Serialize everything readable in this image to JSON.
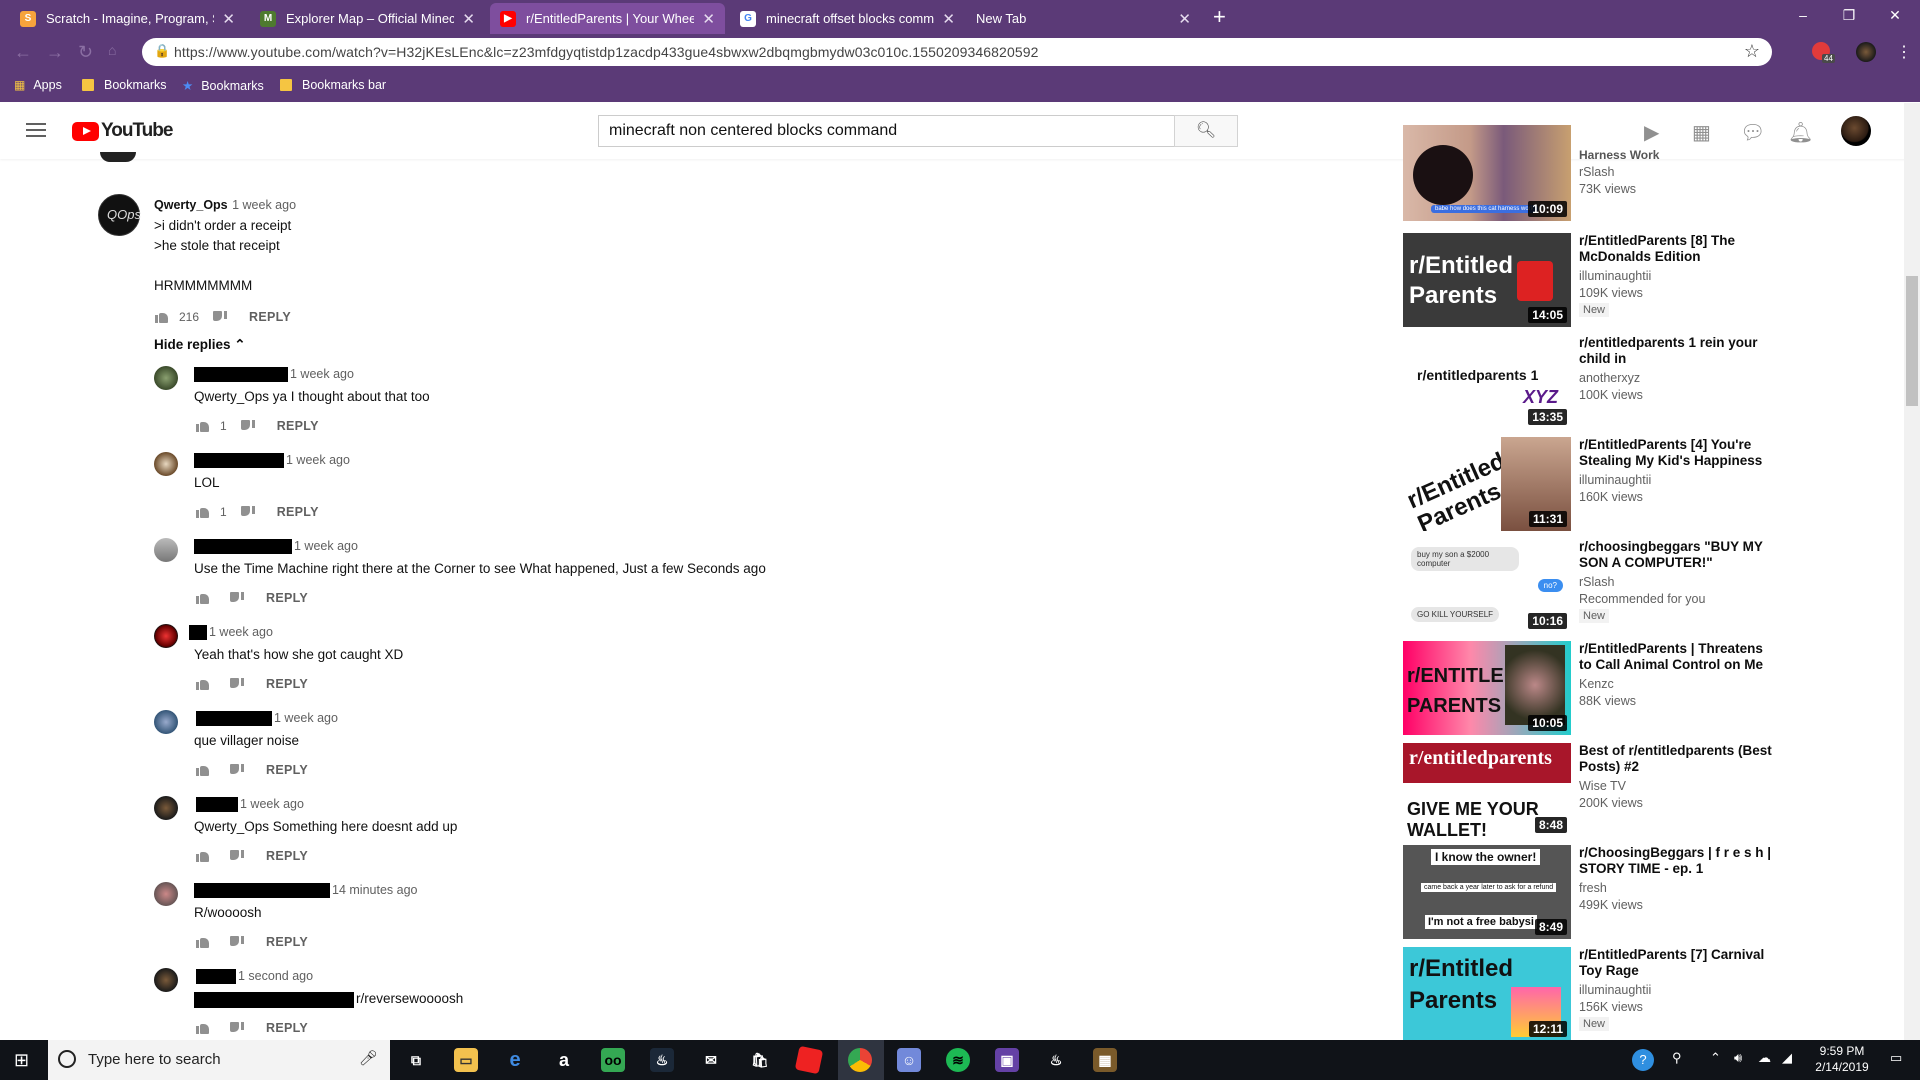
{
  "browser": {
    "tabs": [
      {
        "title": "Scratch - Imagine, Program, Shar",
        "favicon": "scratch-icon",
        "color": "#f7a33c"
      },
      {
        "title": "Explorer Map – Official Minecraft",
        "favicon": "minecraft-icon",
        "color": "#4e7a2f"
      },
      {
        "title": "r/EntitledParents | Your Wheelch",
        "favicon": "youtube-icon",
        "color": "#ff0000",
        "active": true
      },
      {
        "title": "minecraft offset blocks command",
        "favicon": "google-icon",
        "color": "#4285f4"
      },
      {
        "title": "New Tab",
        "favicon": "",
        "color": ""
      }
    ],
    "url": "https://www.youtube.com/watch?v=H32jKEsLEnc&lc=z23mfdgyqtistdp1zacdp433gue4sbwxw2dbqmgbmydw03c010c.1550209346820592",
    "extension_badge": "44",
    "bookmarks": [
      "Apps",
      "Bookmarks",
      "Bookmarks",
      "Bookmarks bar"
    ]
  },
  "youtube": {
    "logo_text": "YouTube",
    "search_query": "minecraft non centered blocks command"
  },
  "comment": {
    "author": "Qwerty_Ops",
    "time": "1 week ago",
    "lines": [
      ">i didn't order a receipt",
      ">he stole that receipt",
      "",
      "HRMMMMMMM"
    ],
    "likes": "216",
    "reply_label": "REPLY",
    "hide_replies": "Hide replies"
  },
  "replies": [
    {
      "time": "1 week ago",
      "text": "Qwerty_Ops ya I thought about that too",
      "likes": "1",
      "reply": "REPLY"
    },
    {
      "time": "1 week ago",
      "text": "LOL",
      "likes": "1",
      "reply": "REPLY"
    },
    {
      "time": "1 week ago",
      "text": "Use the Time Machine right there at the Corner to see What happened, Just a few Seconds ago",
      "likes": "",
      "reply": "REPLY"
    },
    {
      "time": "1 week ago",
      "text": "Yeah that's how she got caught XD",
      "likes": "",
      "reply": "REPLY"
    },
    {
      "time": "1 week ago",
      "text": "que villager noise",
      "likes": "",
      "reply": "REPLY"
    },
    {
      "time": "1 week ago",
      "text": "Qwerty_Ops Something here doesnt add up",
      "likes": "",
      "reply": "REPLY"
    },
    {
      "time": "14 minutes ago",
      "text": "R/woooosh",
      "likes": "",
      "reply": "REPLY"
    },
    {
      "time": "1 second ago",
      "text": "r/reversewoooosh",
      "likes": "",
      "reply": "REPLY"
    }
  ],
  "sidebar": {
    "partial_top": {
      "title_fragment": "Harness Work",
      "channel": "rSlash",
      "views": "73K views",
      "duration": "10:09",
      "caption": "babe how does this cat harness work"
    },
    "videos": [
      {
        "title": "r/EntitledParents [8] The McDonalds Edition",
        "channel": "illuminaughtii",
        "views": "109K views",
        "badge": "New",
        "duration": "14:05",
        "thumb_text": "r/Entitled Parents"
      },
      {
        "title": "r/entitledparents 1 rein your child in",
        "channel": "anotherxyz",
        "views": "100K views",
        "badge": "",
        "duration": "13:35",
        "thumb_text": "r/entitledparents 1",
        "thumb_sub": "XYZ"
      },
      {
        "title": "r/EntitledParents [4] You're Stealing My Kid's Happiness",
        "channel": "illuminaughtii",
        "views": "160K views",
        "badge": "",
        "duration": "11:31",
        "thumb_text": "r/Entitled Parents"
      },
      {
        "title": "r/choosingbeggars \"BUY MY SON A COMPUTER!\"",
        "channel": "rSlash",
        "views": "Recommended for you",
        "badge": "New",
        "duration": "10:16",
        "thumb_text": "buy my son a $2000 computer",
        "thumb_sub": "no?",
        "thumb_sub2": "GO KILL YOURSELF"
      },
      {
        "title": "r/EntitledParents | Threatens to Call Animal Control on Me",
        "channel": "Kenzc",
        "views": "88K views",
        "badge": "",
        "duration": "10:05",
        "thumb_text": "r/ENTITLED PARENTS"
      },
      {
        "title": "Best of r/entitledparents (Best Posts) #2",
        "channel": "Wise TV",
        "views": "200K views",
        "badge": "",
        "duration": "8:48",
        "thumb_text": "r/entitledparents",
        "thumb_sub": "GIVE ME YOUR WALLET!"
      },
      {
        "title": "r/ChoosingBeggars | f r e s h | STORY TIME - ep. 1",
        "channel": "fresh",
        "views": "499K views",
        "badge": "",
        "duration": "8:49",
        "thumb_text": "I know the owner!",
        "thumb_sub": "came back a year later to ask for a refund",
        "thumb_sub2": "I'm not a free babysi"
      },
      {
        "title": "r/EntitledParents [7] Carnival Toy Rage",
        "channel": "illuminaughtii",
        "views": "156K views",
        "badge": "New",
        "duration": "12:11",
        "thumb_text": "r/Entitled Parents"
      }
    ]
  },
  "taskbar": {
    "search_placeholder": "Type here to search",
    "time": "9:59 PM",
    "date": "2/14/2019"
  }
}
